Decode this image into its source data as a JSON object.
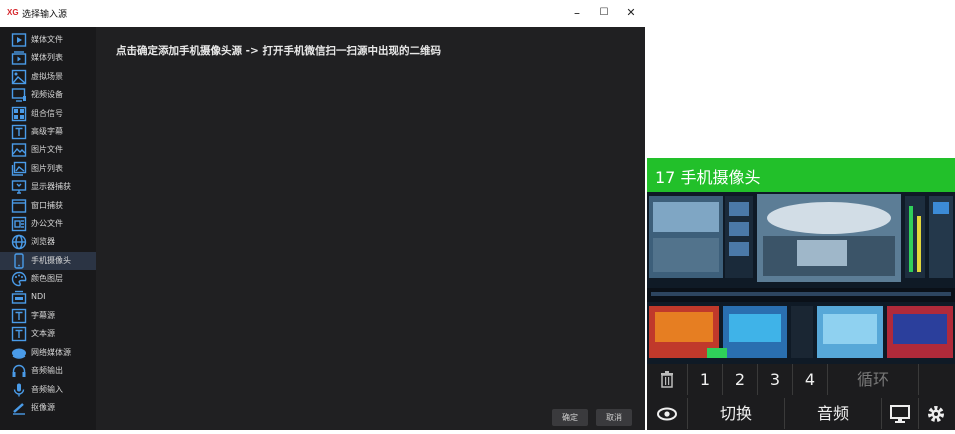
{
  "window": {
    "logo": "XG",
    "title": "选择输入源",
    "minimize": "–",
    "maximize": "☐",
    "close": "✕"
  },
  "sidebar": {
    "items": [
      {
        "label": "媒体文件",
        "icon": "play-icon"
      },
      {
        "label": "媒体列表",
        "icon": "media-list-icon"
      },
      {
        "label": "虚拟场景",
        "icon": "virtual-scene-icon"
      },
      {
        "label": "视频设备",
        "icon": "video-device-icon"
      },
      {
        "label": "组合信号",
        "icon": "grid-icon"
      },
      {
        "label": "高级字幕",
        "icon": "text-t-icon"
      },
      {
        "label": "图片文件",
        "icon": "image-icon"
      },
      {
        "label": "图片列表",
        "icon": "image-list-icon"
      },
      {
        "label": "显示器捕获",
        "icon": "monitor-icon"
      },
      {
        "label": "窗口捕获",
        "icon": "window-icon"
      },
      {
        "label": "办公文件",
        "icon": "office-icon"
      },
      {
        "label": "浏览器",
        "icon": "globe-icon"
      },
      {
        "label": "手机摄像头",
        "icon": "phone-icon"
      },
      {
        "label": "颜色图层",
        "icon": "palette-icon"
      },
      {
        "label": "NDI",
        "icon": "ndi-icon"
      },
      {
        "label": "字幕源",
        "icon": "text-t-icon"
      },
      {
        "label": "文本源",
        "icon": "text-t-icon"
      },
      {
        "label": "网络媒体源",
        "icon": "network-icon"
      },
      {
        "label": "音频输出",
        "icon": "headphones-icon"
      },
      {
        "label": "音频输入",
        "icon": "microphone-icon"
      },
      {
        "label": "抠像源",
        "icon": "keying-icon"
      }
    ],
    "active_index": 12
  },
  "content": {
    "instruction": "点击确定添加手机摄像头源 -> 打开手机微信扫一扫源中出现的二维码",
    "ok": "确定",
    "cancel": "取消"
  },
  "preview": {
    "title": "17 手机摄像头",
    "row1": [
      "1",
      "2",
      "3",
      "4",
      "循环"
    ],
    "row2": [
      "切换",
      "音频"
    ],
    "icons": [
      "trash-icon",
      "eye-icon",
      "monitor-icon",
      "gear-icon"
    ]
  },
  "colors": {
    "accent_green": "#22c02a",
    "sidebar_active": "#2b3444",
    "icon_blue": "#4a9be8"
  }
}
